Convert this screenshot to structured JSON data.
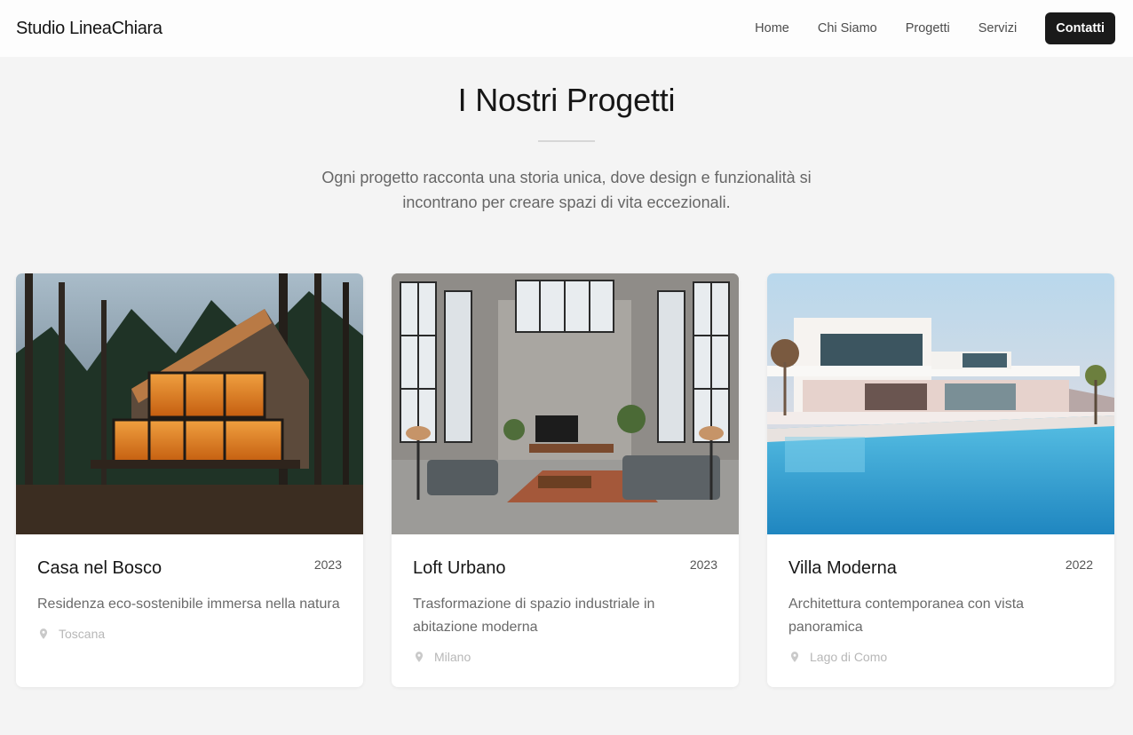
{
  "brand": "Studio LineaChiara",
  "nav": {
    "items": [
      "Home",
      "Chi Siamo",
      "Progetti",
      "Servizi"
    ],
    "cta": "Contatti"
  },
  "hero": {
    "title": "I Nostri Progetti",
    "subtitle": "Ogni progetto racconta una storia unica, dove design e funzionalità si incontrano per creare spazi di vita eccezionali."
  },
  "projects": [
    {
      "title": "Casa nel Bosco",
      "year": "2023",
      "description": "Residenza eco-sostenibile immersa nella natura",
      "location": "Toscana",
      "image": "forest-house-photo"
    },
    {
      "title": "Loft Urbano",
      "year": "2023",
      "description": "Trasformazione di spazio industriale in abitazione moderna",
      "location": "Milano",
      "image": "industrial-loft-photo"
    },
    {
      "title": "Villa Moderna",
      "year": "2022",
      "description": "Architettura contemporanea con vista panoramica",
      "location": "Lago di Como",
      "image": "villa-pool-photo"
    }
  ],
  "colors": {
    "background": "#f4f4f4",
    "cta": "#1a1a1a",
    "card": "#ffffff"
  },
  "icons": {
    "location": "map-pin-icon"
  }
}
